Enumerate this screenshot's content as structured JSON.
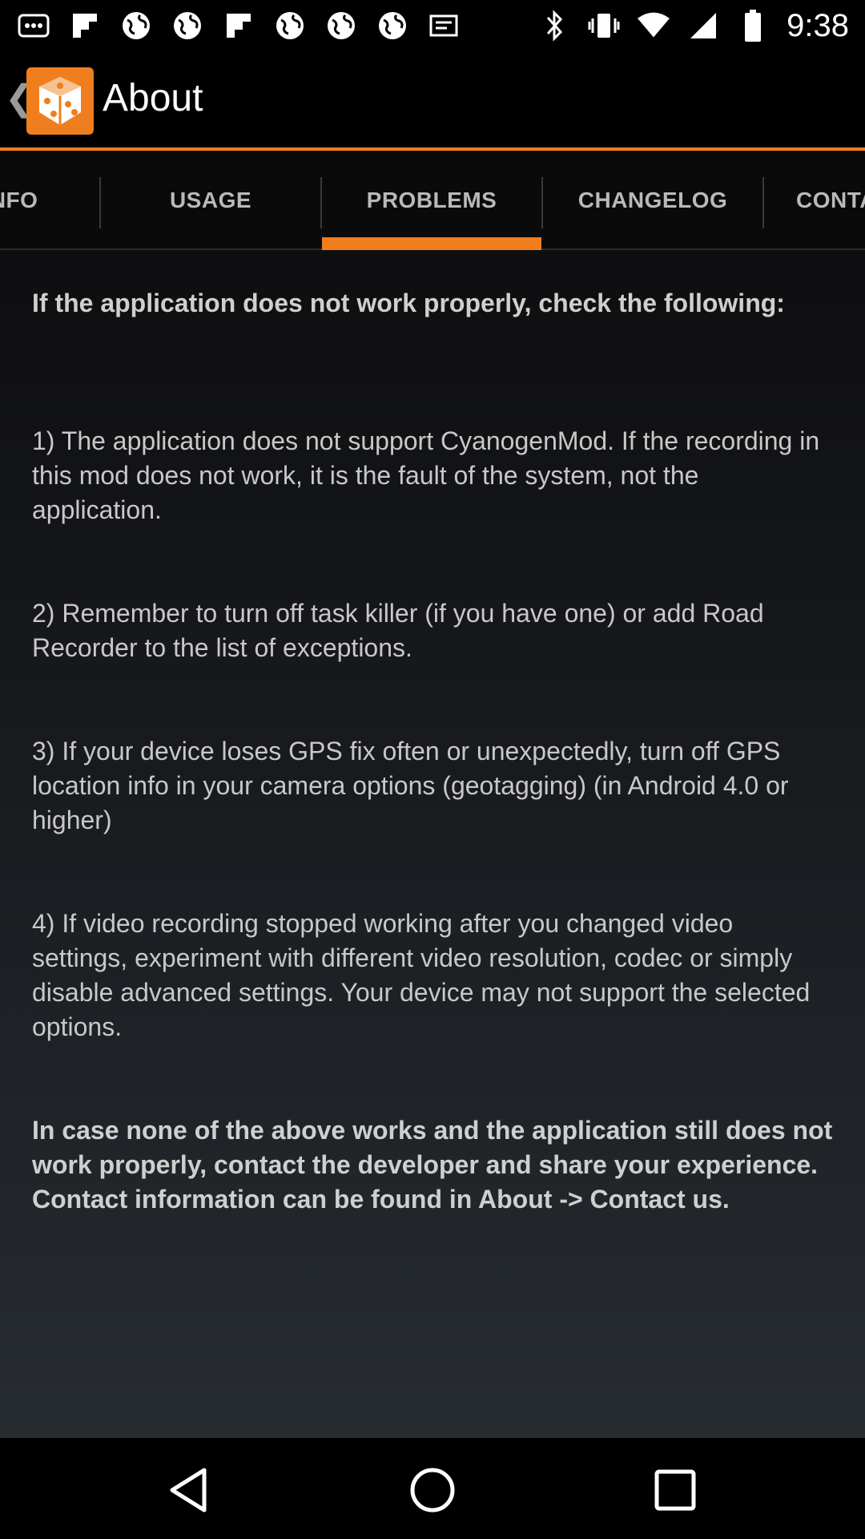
{
  "status_bar": {
    "time": "9:38",
    "left_icons": [
      "notification-icon",
      "flipboard-icon",
      "globe-icon",
      "globe-icon",
      "flipboard-icon",
      "globe-icon",
      "globe-icon",
      "globe-icon",
      "message-icon"
    ],
    "right_icons": [
      "bluetooth-icon",
      "vibrate-icon",
      "wifi-icon",
      "signal-icon",
      "battery-icon"
    ]
  },
  "action_bar": {
    "title": "About",
    "accent_color": "#f07e1e"
  },
  "tabs": [
    {
      "label": "INFO",
      "active": false
    },
    {
      "label": "USAGE",
      "active": false
    },
    {
      "label": "PROBLEMS",
      "active": true
    },
    {
      "label": "CHANGELOG",
      "active": false
    },
    {
      "label": "CONTACT",
      "active": false
    }
  ],
  "content": {
    "intro": "If the application does not work properly, check the following:",
    "items": [
      "1) The application does not support CyanogenMod. If the recording in this mod does not work, it is the fault of the system, not the application.",
      "2) Remember to turn off task killer (if you have one) or add Road Recorder to the list of exceptions.",
      "3) If your device loses GPS fix often or unexpectedly, turn off GPS location info in your camera options (geotagging) (in Android 4.0 or higher)",
      "4) If video recording stopped working after you changed video settings, experiment with different video resolution, codec or simply disable advanced settings. Your device may not support the selected options."
    ],
    "outro": "In case none of the above works and the application still does not work properly, contact the developer and share your experience. Contact information can be found in About -> Contact us."
  },
  "nav_bar": {
    "buttons": [
      "back-icon",
      "home-icon",
      "recents-icon"
    ]
  }
}
